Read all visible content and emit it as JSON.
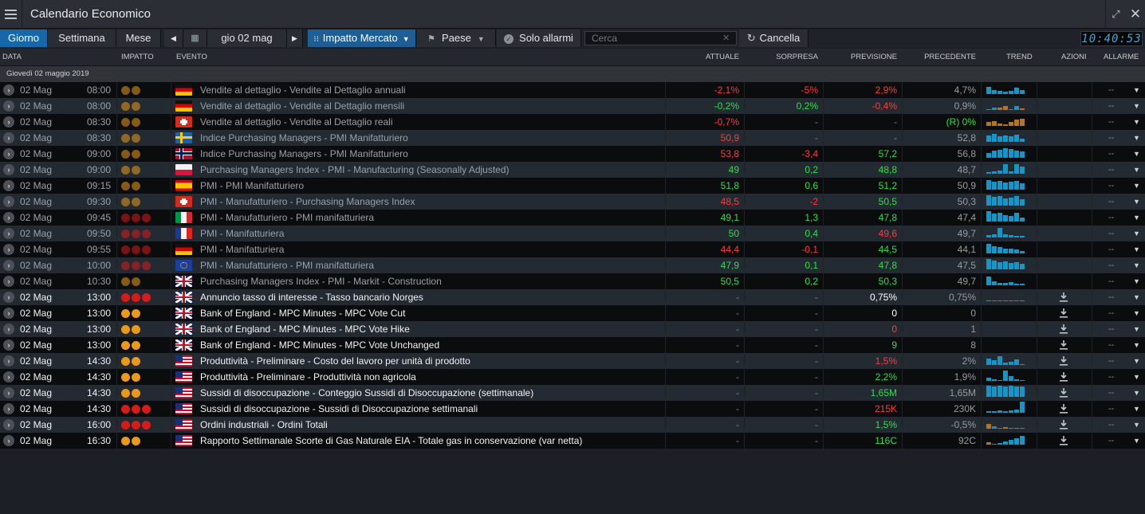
{
  "app": {
    "title": "Calendario Economico",
    "expand_icon": "expand-icon",
    "close_icon": "close-icon"
  },
  "toolbar": {
    "tabs": [
      "Giorno",
      "Settimana",
      "Mese"
    ],
    "active_tab": "Giorno",
    "date_label": "gio 02 mag",
    "impact_filter": "Impatto Mercato",
    "country_filter": "Paese",
    "alarms_only": "Solo allarmi",
    "search_placeholder": "Cerca",
    "clear_label": "Cancella",
    "clock": "10:40:53"
  },
  "columns": {
    "date": "DATA",
    "impact": "IMPATTO",
    "event": "EVENTO",
    "actual": "ATTUALE",
    "surprise": "SORPRESA",
    "forecast": "PREVISIONE",
    "previous": "PRECEDENTE",
    "trend": "TREND",
    "actions": "AZIONI",
    "alarms": "ALLARME"
  },
  "date_group": "Giovedì 02 maggio 2019",
  "colors": {
    "impact_medium": "#e99a1b",
    "impact_high": "#d61b1b",
    "positive": "#2be04a",
    "negative": "#ff3b3b",
    "accent": "#1668a8"
  },
  "rows": [
    {
      "date": "02 Mag",
      "time": "08:00",
      "impact": 2,
      "country": "de",
      "event": "Vendite al dettaglio - Vendite al Dettaglio annuali",
      "actual": "-2,1%",
      "actual_c": "red",
      "surprise": "-5%",
      "surprise_c": "red",
      "forecast": "2,9%",
      "forecast_c": "red",
      "previous": "4,7%",
      "dim": true,
      "trend": [
        9,
        5,
        4,
        3,
        4,
        8,
        5
      ],
      "trend_neg": [
        0,
        0,
        0,
        0,
        0,
        0,
        0
      ],
      "alarm": "--",
      "download": false
    },
    {
      "date": "02 Mag",
      "time": "08:00",
      "impact": 2,
      "country": "de",
      "event": "Vendite al dettaglio - Vendite al Dettaglio mensili",
      "actual": "-0,2%",
      "actual_c": "green",
      "surprise": "0,2%",
      "surprise_c": "green",
      "forecast": "-0,4%",
      "forecast_c": "red",
      "previous": "0,9%",
      "dim": true,
      "trend": [
        0,
        3,
        0,
        0,
        0,
        5,
        0
      ],
      "trend_neg": [
        0,
        0,
        3,
        5,
        0,
        0,
        2
      ],
      "alarm": "--",
      "download": false
    },
    {
      "date": "02 Mag",
      "time": "08:30",
      "impact": 2,
      "country": "ch",
      "event": "Vendite al dettaglio - Vendite al Dettaglio reali",
      "actual": "-0,7%",
      "actual_c": "red",
      "surprise": "-",
      "surprise_c": "dim",
      "forecast": "-",
      "forecast_c": "dim",
      "previous": "(R) 0%",
      "previous_c": "green",
      "dim": true,
      "trend": [
        0,
        0,
        0,
        0,
        0,
        0,
        0
      ],
      "trend_neg": [
        5,
        6,
        3,
        2,
        5,
        8,
        9
      ],
      "alarm": "--",
      "download": false
    },
    {
      "date": "02 Mag",
      "time": "08:30",
      "impact": 2,
      "country": "se",
      "event": "Indice Purchasing Managers - PMI Manifatturiero",
      "actual": "50,9",
      "actual_c": "red",
      "surprise": "-",
      "surprise_c": "dim",
      "forecast": "-",
      "forecast_c": "dim",
      "previous": "52,8",
      "dim": true,
      "trend": [
        8,
        10,
        7,
        8,
        7,
        9,
        4
      ],
      "trend_neg": [
        0,
        0,
        0,
        0,
        0,
        0,
        0
      ],
      "alarm": "--",
      "download": false
    },
    {
      "date": "02 Mag",
      "time": "09:00",
      "impact": 2,
      "country": "no",
      "event": "Indice Purchasing Managers - PMI Manifatturiero",
      "actual": "53,8",
      "actual_c": "red",
      "surprise": "-3,4",
      "surprise_c": "red",
      "forecast": "57,2",
      "forecast_c": "green",
      "previous": "56,8",
      "dim": true,
      "trend": [
        6,
        9,
        10,
        12,
        11,
        9,
        8
      ],
      "trend_neg": [
        0,
        0,
        0,
        0,
        0,
        0,
        0
      ],
      "alarm": "--",
      "download": false
    },
    {
      "date": "02 Mag",
      "time": "09:00",
      "impact": 2,
      "country": "pl",
      "event": "Purchasing Managers Index - PMI - Manufacturing (Seasonally Adjusted)",
      "actual": "49",
      "actual_c": "green",
      "surprise": "0,2",
      "surprise_c": "green",
      "forecast": "48,8",
      "forecast_c": "green",
      "previous": "48,7",
      "dim": true,
      "trend": [
        2,
        3,
        4,
        12,
        3,
        12,
        9
      ],
      "trend_neg": [
        0,
        0,
        0,
        0,
        0,
        0,
        0
      ],
      "alarm": "--",
      "download": false
    },
    {
      "date": "02 Mag",
      "time": "09:15",
      "impact": 2,
      "country": "es",
      "event": "PMI - PMI Manifatturiero",
      "actual": "51,8",
      "actual_c": "green",
      "surprise": "0,6",
      "surprise_c": "green",
      "forecast": "51,2",
      "forecast_c": "green",
      "previous": "50,9",
      "dim": true,
      "trend": [
        12,
        10,
        11,
        9,
        10,
        11,
        8
      ],
      "trend_neg": [
        0,
        0,
        0,
        0,
        0,
        0,
        0
      ],
      "alarm": "--",
      "download": false
    },
    {
      "date": "02 Mag",
      "time": "09:30",
      "impact": 2,
      "country": "ch",
      "event": "PMI - Manufatturiero - Purchasing Managers Index",
      "actual": "48,5",
      "actual_c": "red",
      "surprise": "-2",
      "surprise_c": "red",
      "forecast": "50,5",
      "forecast_c": "green",
      "previous": "50,3",
      "dim": true,
      "trend": [
        13,
        11,
        12,
        9,
        10,
        12,
        8
      ],
      "trend_neg": [
        0,
        0,
        0,
        0,
        0,
        0,
        0
      ],
      "alarm": "--",
      "download": false
    },
    {
      "date": "02 Mag",
      "time": "09:45",
      "impact": 3,
      "country": "it",
      "event": "PMI - Manufatturiero - PMI manifatturiera",
      "actual": "49,1",
      "actual_c": "green",
      "surprise": "1,3",
      "surprise_c": "green",
      "forecast": "47,8",
      "forecast_c": "green",
      "previous": "47,4",
      "dim": true,
      "trend": [
        13,
        10,
        11,
        8,
        7,
        11,
        5
      ],
      "trend_neg": [
        0,
        0,
        0,
        0,
        0,
        0,
        0
      ],
      "alarm": "--",
      "download": false
    },
    {
      "date": "02 Mag",
      "time": "09:50",
      "impact": 3,
      "country": "fr",
      "event": "PMI - Manifatturiera",
      "actual": "50",
      "actual_c": "green",
      "surprise": "0,4",
      "surprise_c": "green",
      "forecast": "49,6",
      "forecast_c": "red",
      "previous": "49,7",
      "dim": true,
      "trend": [
        3,
        4,
        12,
        4,
        3,
        2,
        2
      ],
      "trend_neg": [
        0,
        0,
        0,
        0,
        0,
        0,
        0
      ],
      "alarm": "--",
      "download": false
    },
    {
      "date": "02 Mag",
      "time": "09:55",
      "impact": 3,
      "country": "de",
      "event": "PMI - Manifatturiera",
      "actual": "44,4",
      "actual_c": "red",
      "surprise": "-0,1",
      "surprise_c": "red",
      "forecast": "44,5",
      "forecast_c": "green",
      "previous": "44,1",
      "dim": true,
      "trend": [
        12,
        9,
        8,
        6,
        6,
        5,
        3
      ],
      "trend_neg": [
        0,
        0,
        0,
        0,
        0,
        0,
        0
      ],
      "alarm": "--",
      "download": false
    },
    {
      "date": "02 Mag",
      "time": "10:00",
      "impact": 3,
      "country": "eu",
      "event": "PMI - Manufatturiero - PMI manifatturiera",
      "actual": "47,9",
      "actual_c": "green",
      "surprise": "0,1",
      "surprise_c": "green",
      "forecast": "47,8",
      "forecast_c": "green",
      "previous": "47,5",
      "dim": true,
      "trend": [
        13,
        11,
        9,
        10,
        8,
        9,
        7
      ],
      "trend_neg": [
        0,
        0,
        0,
        0,
        0,
        0,
        0
      ],
      "alarm": "--",
      "download": false
    },
    {
      "date": "02 Mag",
      "time": "10:30",
      "impact": 2,
      "country": "gb",
      "event": "Purchasing Managers Index - PMI - Markit - Construction",
      "actual": "50,5",
      "actual_c": "green",
      "surprise": "0,2",
      "surprise_c": "green",
      "forecast": "50,3",
      "forecast_c": "green",
      "previous": "49,7",
      "dim": true,
      "trend": [
        11,
        5,
        3,
        3,
        4,
        2,
        2
      ],
      "trend_neg": [
        0,
        0,
        0,
        0,
        0,
        0,
        0
      ],
      "alarm": "--",
      "download": false
    },
    {
      "date": "02 Mag",
      "time": "13:00",
      "impact": 3,
      "country": "gb",
      "event": "Annuncio tasso di interesse - Tasso bancario Norges",
      "actual": "-",
      "actual_c": "dim",
      "surprise": "-",
      "surprise_c": "dim",
      "forecast": "0,75%",
      "forecast_c": "white",
      "previous": "0,75%",
      "dim": false,
      "trend": [
        1,
        1,
        1,
        1,
        1,
        1,
        1
      ],
      "trend_neg": [
        0,
        0,
        0,
        0,
        0,
        0,
        0
      ],
      "alarm": "--",
      "download": true
    },
    {
      "date": "02 Mag",
      "time": "13:00",
      "impact": 2,
      "country": "gb",
      "event": "Bank of England - MPC Minutes - MPC Vote Cut",
      "actual": "-",
      "actual_c": "dim",
      "surprise": "-",
      "surprise_c": "dim",
      "forecast": "0",
      "forecast_c": "white",
      "previous": "0",
      "dim": false,
      "trend": [
        0,
        0,
        0,
        0,
        0,
        0,
        0
      ],
      "trend_neg": [
        0,
        0,
        0,
        0,
        0,
        0,
        0
      ],
      "alarm": "--",
      "download": true
    },
    {
      "date": "02 Mag",
      "time": "13:00",
      "impact": 2,
      "country": "gb",
      "event": "Bank of England - MPC Minutes - MPC Vote Hike",
      "actual": "-",
      "actual_c": "dim",
      "surprise": "-",
      "surprise_c": "dim",
      "forecast": "0",
      "forecast_c": "red",
      "previous": "1",
      "dim": false,
      "trend": [
        0,
        0,
        0,
        0,
        0,
        0,
        0
      ],
      "trend_neg": [
        0,
        0,
        0,
        0,
        0,
        0,
        0
      ],
      "alarm": "--",
      "download": true
    },
    {
      "date": "02 Mag",
      "time": "13:00",
      "impact": 2,
      "country": "gb",
      "event": "Bank of England - MPC Minutes - MPC Vote Unchanged",
      "actual": "-",
      "actual_c": "dim",
      "surprise": "-",
      "surprise_c": "dim",
      "forecast": "9",
      "forecast_c": "green",
      "previous": "8",
      "dim": false,
      "trend": [
        0,
        0,
        0,
        0,
        0,
        0,
        0
      ],
      "trend_neg": [
        0,
        0,
        0,
        0,
        0,
        0,
        0
      ],
      "alarm": "--",
      "download": true
    },
    {
      "date": "02 Mag",
      "time": "14:30",
      "impact": 2,
      "country": "us",
      "event": "Produttività - Preliminare - Costo del lavoro per unità di prodotto",
      "actual": "-",
      "actual_c": "dim",
      "surprise": "-",
      "surprise_c": "dim",
      "forecast": "1,5%",
      "forecast_c": "red",
      "previous": "2%",
      "dim": false,
      "trend": [
        8,
        6,
        11,
        3,
        4,
        7,
        1
      ],
      "trend_neg": [
        0,
        0,
        0,
        0,
        0,
        0,
        0
      ],
      "alarm": "--",
      "download": true
    },
    {
      "date": "02 Mag",
      "time": "14:30",
      "impact": 2,
      "country": "us",
      "event": "Produttività - Preliminare - Produttività non agricola",
      "actual": "-",
      "actual_c": "dim",
      "surprise": "-",
      "surprise_c": "dim",
      "forecast": "2,2%",
      "forecast_c": "green",
      "previous": "1,9%",
      "dim": false,
      "trend": [
        4,
        2,
        1,
        13,
        6,
        2,
        1
      ],
      "trend_neg": [
        0,
        0,
        0,
        0,
        0,
        0,
        0
      ],
      "alarm": "--",
      "download": true
    },
    {
      "date": "02 Mag",
      "time": "14:30",
      "impact": 2,
      "country": "us",
      "event": "Sussidi di disoccupazione - Conteggio Sussidi di Disoccupazione (settimanale)",
      "actual": "-",
      "actual_c": "dim",
      "surprise": "-",
      "surprise_c": "dim",
      "forecast": "1,65M",
      "forecast_c": "green",
      "previous": "1,65M",
      "dim": false,
      "trend": [
        14,
        13,
        14,
        13,
        14,
        13,
        13
      ],
      "trend_neg": [
        0,
        0,
        0,
        0,
        0,
        0,
        0
      ],
      "alarm": "--",
      "download": true
    },
    {
      "date": "02 Mag",
      "time": "14:30",
      "impact": 3,
      "country": "us",
      "event": "Sussidi di disoccupazione - Sussidi di Disoccupazione settimanali",
      "actual": "-",
      "actual_c": "dim",
      "surprise": "-",
      "surprise_c": "dim",
      "forecast": "215K",
      "forecast_c": "red",
      "previous": "230K",
      "dim": false,
      "trend": [
        2,
        2,
        3,
        2,
        3,
        4,
        14
      ],
      "trend_neg": [
        0,
        0,
        0,
        0,
        0,
        0,
        0
      ],
      "alarm": "--",
      "download": true
    },
    {
      "date": "02 Mag",
      "time": "16:00",
      "impact": 3,
      "country": "us",
      "event": "Ordini industriali - Ordini Totali",
      "actual": "-",
      "actual_c": "dim",
      "surprise": "-",
      "surprise_c": "dim",
      "forecast": "1,5%",
      "forecast_c": "green",
      "previous": "-0,5%",
      "dim": false,
      "trend": [
        2,
        3,
        1,
        0,
        1,
        0,
        1
      ],
      "trend_neg": [
        6,
        0,
        0,
        2,
        0,
        1,
        0
      ],
      "alarm": "--",
      "download": true
    },
    {
      "date": "02 Mag",
      "time": "16:30",
      "impact": 2,
      "country": "us",
      "event": "Rapporto Settimanale Scorte di Gas Naturale EIA - Totale gas in conservazione (var netta)",
      "actual": "-",
      "actual_c": "dim",
      "surprise": "-",
      "surprise_c": "dim",
      "forecast": "116C",
      "forecast_c": "green",
      "previous": "92C",
      "dim": false,
      "trend": [
        1,
        1,
        2,
        4,
        6,
        8,
        11
      ],
      "trend_neg": [
        3,
        0,
        0,
        0,
        0,
        0,
        0
      ],
      "alarm": "--",
      "download": true
    }
  ]
}
